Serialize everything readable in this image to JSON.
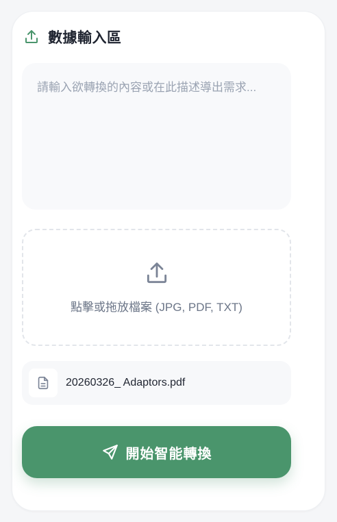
{
  "header": {
    "title": "數據輸入區",
    "icon": "upload-icon"
  },
  "input": {
    "placeholder": "請輸入欲轉換的內容或在此描述導出需求...",
    "value": ""
  },
  "dropzone": {
    "icon": "upload-icon",
    "label": "點擊或拖放檔案 (JPG, PDF, TXT)"
  },
  "file": {
    "icon": "document-icon",
    "name": "20260326_ Adaptors.pdf"
  },
  "submit": {
    "icon": "send-icon",
    "label": "開始智能轉換"
  },
  "colors": {
    "accent": "#4a956c",
    "text_primary": "#1f2430",
    "text_muted": "#9aa3b2"
  }
}
